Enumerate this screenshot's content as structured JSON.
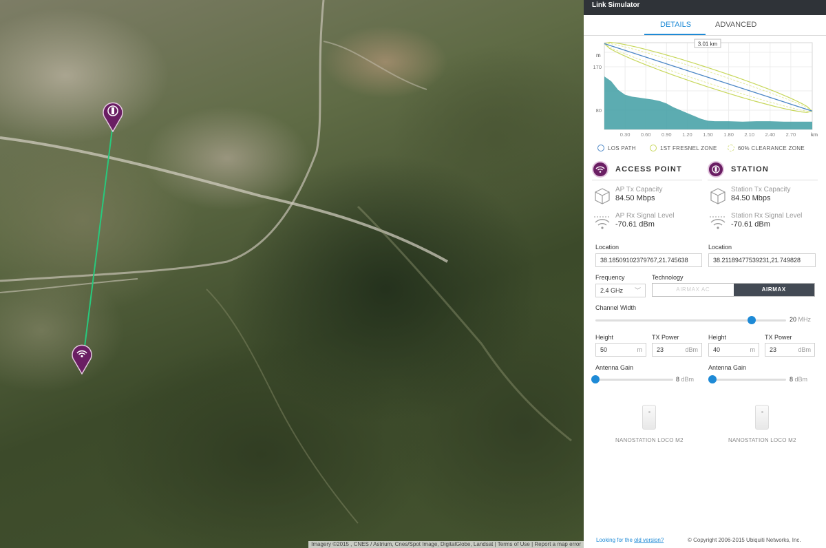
{
  "panel": {
    "title": "Link Simulator",
    "tabs": [
      {
        "label": "DETAILS",
        "active": true
      },
      {
        "label": "ADVANCED",
        "active": false
      }
    ]
  },
  "chart_data": {
    "type": "area",
    "distance_label": "3.01 km",
    "ylabel": "m",
    "xlabel": "km",
    "y_ticks": [
      "170",
      "80"
    ],
    "x_ticks": [
      "0.30",
      "0.60",
      "0.90",
      "1.20",
      "1.50",
      "1.80",
      "2.10",
      "2.40",
      "2.70"
    ],
    "terrain": {
      "x": [
        0,
        0.1,
        0.2,
        0.3,
        0.4,
        0.5,
        0.6,
        0.7,
        0.8,
        0.9,
        1.0,
        1.1,
        1.2,
        1.3,
        1.4,
        1.5,
        1.6,
        1.8,
        2.0,
        2.2,
        2.4,
        2.6,
        2.8,
        3.01
      ],
      "y": [
        150,
        140,
        122,
        112,
        108,
        106,
        104,
        102,
        99,
        94,
        86,
        80,
        74,
        68,
        62,
        58,
        57,
        57,
        56,
        57,
        57,
        56,
        56,
        56
      ]
    },
    "los_path": {
      "start": 218,
      "end": 78
    },
    "grid": true,
    "legend_position": "bottom",
    "legend": [
      {
        "label": "LOS PATH",
        "color": "#4a86c5"
      },
      {
        "label": "1ST FRESNEL ZONE",
        "color": "#c7d75a"
      },
      {
        "label": "60% CLEARANCE ZONE",
        "color": "#e3ea9c"
      }
    ]
  },
  "access_point": {
    "heading": "ACCESS POINT",
    "tx_label": "AP Tx Capacity",
    "tx_value": "84.50 Mbps",
    "rx_label": "AP Rx Signal Level",
    "rx_value": "-70.61 dBm",
    "location_label": "Location",
    "location_value": "38.18509102379767,21.745638",
    "height_label": "Height",
    "height_value": "50",
    "height_unit": "m",
    "txpower_label": "TX Power",
    "txpower_value": "23",
    "txpower_unit": "dBm",
    "gain_label": "Antenna Gain",
    "gain_value": "8",
    "gain_unit": "dBm",
    "device": "NANOSTATION LOCO M2"
  },
  "station": {
    "heading": "STATION",
    "tx_label": "Station Tx Capacity",
    "tx_value": "84.50 Mbps",
    "rx_label": "Station Rx Signal Level",
    "rx_value": "-70.61 dBm",
    "location_label": "Location",
    "location_value": "38.21189477539231,21.749828",
    "height_label": "Height",
    "height_value": "40",
    "height_unit": "m",
    "txpower_label": "TX Power",
    "txpower_value": "23",
    "txpower_unit": "dBm",
    "gain_label": "Antenna Gain",
    "gain_value": "8",
    "gain_unit": "dBm",
    "device": "NANOSTATION LOCO M2"
  },
  "frequency": {
    "label": "Frequency",
    "value": "2.4 GHz"
  },
  "technology": {
    "label": "Technology",
    "options": [
      "AIRMAX AC",
      "AIRMAX"
    ],
    "selected": "AIRMAX"
  },
  "channel_width": {
    "label": "Channel Width",
    "value": "20",
    "unit": "MHz",
    "level": 0.82
  },
  "gain_level": 0.0,
  "footer": {
    "prefix": "Looking for the ",
    "link": "old version?",
    "copyright": "© Copyright 2006-2015 Ubiquiti Networks, Inc."
  },
  "map": {
    "attribution": "Imagery ©2015 , CNES / Astrium, Cnes/Spot Image, DigitalGlobe, Landsat  |  Terms of Use  |  Report a map error"
  },
  "colors": {
    "accent": "#1e8ad6",
    "pin": "#6a1e63",
    "link_line": "#28c97d",
    "terrain": "#4aa3a8"
  }
}
